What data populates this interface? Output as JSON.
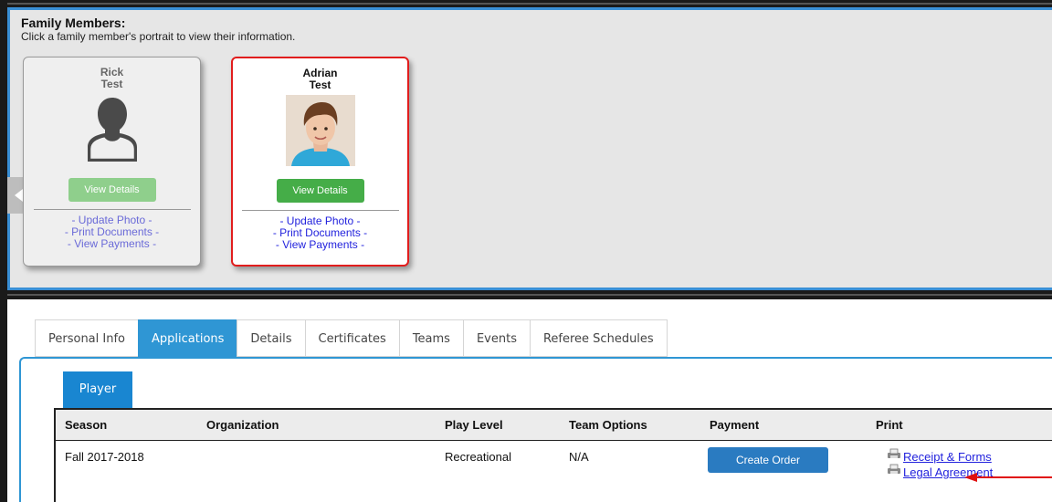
{
  "family": {
    "title": "Family Members:",
    "subtitle": "Click a family member's portrait to view their information.",
    "members": [
      {
        "first": "Rick",
        "last": "Test",
        "view_label": "View Details",
        "links": [
          "- Update Photo -",
          "- Print Documents -",
          "- View Payments -"
        ]
      },
      {
        "first": "Adrian",
        "last": "Test",
        "view_label": "View Details",
        "links": [
          "- Update Photo -",
          "- Print Documents -",
          "- View Payments -"
        ]
      }
    ]
  },
  "tabs": [
    "Personal Info",
    "Applications",
    "Details",
    "Certificates",
    "Teams",
    "Events",
    "Referee Schedules"
  ],
  "active_tab": "Applications",
  "subtab": "Player",
  "table": {
    "headers": [
      "Season",
      "Organization",
      "Play Level",
      "Team Options",
      "Payment",
      "Print"
    ],
    "rows": [
      {
        "season": "Fall 2017-2018",
        "organization": "",
        "play_level": "Recreational",
        "team_options": "N/A",
        "payment_button": "Create Order",
        "print_links": [
          "Receipt & Forms",
          "Legal Agreement"
        ]
      }
    ]
  },
  "icons": {
    "nav_left": "chevron-left-icon",
    "placeholder_portrait": "person-silhouette-icon",
    "print": "printer-icon",
    "annotation": "red-arrow-icon"
  },
  "colors": {
    "accent": "#2f96d4",
    "selected_card_border": "#e11d1d",
    "view_button": "#45ad48",
    "link": "#2222dd"
  }
}
